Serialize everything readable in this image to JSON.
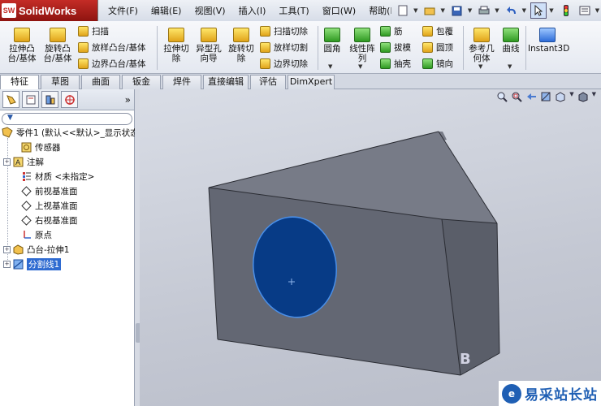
{
  "app": {
    "name": "SolidWorks",
    "logo_badge": "SW"
  },
  "menu": [
    "文件(F)",
    "编辑(E)",
    "视图(V)",
    "插入(I)",
    "工具(T)",
    "窗口(W)",
    "帮助(H)"
  ],
  "quickbar": {
    "icons": [
      "new-document-icon",
      "open-folder-icon",
      "save-icon",
      "print-icon",
      "undo-icon",
      "select-arrow-icon",
      "rebuild-icon",
      "options-icon"
    ]
  },
  "ribbon": {
    "big": [
      {
        "label": "拉伸凸\n台/基体",
        "icon": "extrude-boss-icon"
      },
      {
        "label": "旋转凸\n台/基体",
        "icon": "revolve-boss-icon"
      },
      {
        "label": "拉伸切\n除",
        "icon": "extrude-cut-icon"
      },
      {
        "label": "异型孔\n向导",
        "icon": "hole-wizard-icon"
      },
      {
        "label": "旋转切\n除",
        "icon": "revolve-cut-icon"
      },
      {
        "label": "圆角",
        "icon": "fillet-icon"
      },
      {
        "label": "线性阵\n列",
        "icon": "linear-pattern-icon"
      },
      {
        "label": "参考几\n何体",
        "icon": "reference-geometry-icon"
      },
      {
        "label": "曲线",
        "icon": "curves-icon"
      },
      {
        "label": "Instant3D",
        "icon": "instant3d-icon"
      }
    ],
    "small": {
      "sweep": "扫描",
      "loft": "放样凸台/基体",
      "boundary": "边界凸台/基体",
      "sweep_cut": "扫描切除",
      "loft_cut": "放样切割",
      "boundary_cut": "边界切除",
      "rib": "筋",
      "draft": "拔模",
      "shell": "抽壳",
      "wrap": "包覆",
      "dome": "圆顶",
      "mirror": "镜向"
    }
  },
  "tabs": [
    "特征",
    "草图",
    "曲面",
    "钣金",
    "焊件",
    "直接编辑",
    "评估",
    "DimXpert"
  ],
  "active_tab": "特征",
  "feature_tree": {
    "root": "零件1 (默认<<默认>_显示状态",
    "items": [
      {
        "label": "传感器",
        "icon": "sensor-icon",
        "expander": ""
      },
      {
        "label": "注解",
        "icon": "annotation-icon",
        "expander": "+"
      },
      {
        "label": "材质 <未指定>",
        "icon": "material-icon",
        "expander": ""
      },
      {
        "label": "前视基准面",
        "icon": "plane-icon",
        "expander": ""
      },
      {
        "label": "上视基准面",
        "icon": "plane-icon",
        "expander": ""
      },
      {
        "label": "右视基准面",
        "icon": "plane-icon",
        "expander": ""
      },
      {
        "label": "原点",
        "icon": "origin-icon",
        "expander": ""
      },
      {
        "label": "凸台-拉伸1",
        "icon": "extrude-feature-icon",
        "expander": "+"
      },
      {
        "label": "分割线1",
        "icon": "split-line-icon",
        "expander": "+"
      }
    ],
    "selected_item": "分割线1"
  },
  "colors": {
    "title_red": "#c42c26",
    "selection_blue": "#2f6bd1",
    "model_face_front": "#636773",
    "model_face_top": "#777b87",
    "model_face_side": "#5a5e69",
    "split_face": "#073b86"
  },
  "watermark": {
    "badge": "e",
    "text": "易采站长站"
  },
  "overlay_glyph": "B"
}
